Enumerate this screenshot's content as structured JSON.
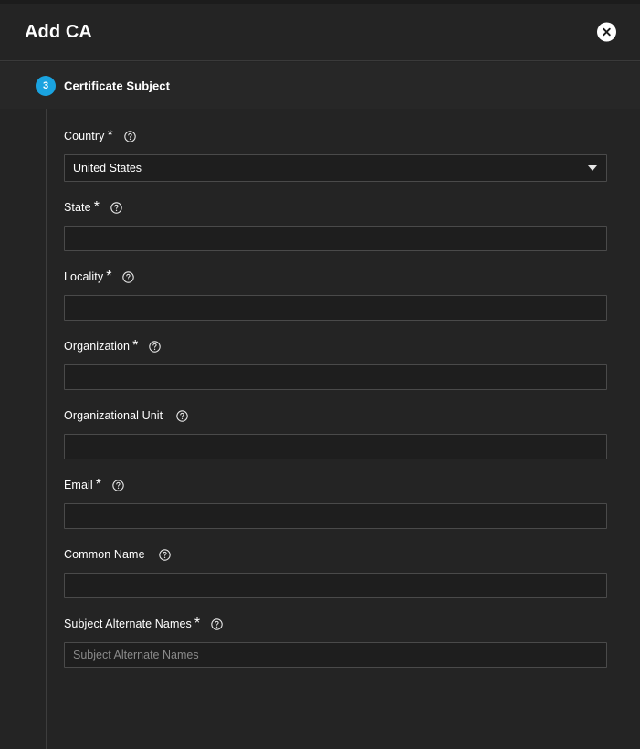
{
  "window": {
    "title": "Add CA",
    "close_icon": "close-circle-icon"
  },
  "step": {
    "number": "3",
    "label": "Certificate Subject"
  },
  "form": {
    "help_icon": "help-circle-icon",
    "dropdown_icon": "chevron-down-icon",
    "fields": [
      {
        "name": "country",
        "label": "Country",
        "required": true,
        "required_mark": "*",
        "type": "select",
        "value": "United States",
        "placeholder": ""
      },
      {
        "name": "state",
        "label": "State",
        "required": true,
        "required_mark": "*",
        "type": "text",
        "value": "",
        "placeholder": ""
      },
      {
        "name": "locality",
        "label": "Locality",
        "required": true,
        "required_mark": "*",
        "type": "text",
        "value": "",
        "placeholder": ""
      },
      {
        "name": "organization",
        "label": "Organization",
        "required": true,
        "required_mark": "*",
        "type": "text",
        "value": "",
        "placeholder": ""
      },
      {
        "name": "organizational-unit",
        "label": "Organizational Unit",
        "required": false,
        "required_mark": "",
        "type": "text",
        "value": "",
        "placeholder": ""
      },
      {
        "name": "email",
        "label": "Email",
        "required": true,
        "required_mark": "*",
        "type": "text",
        "value": "",
        "placeholder": ""
      },
      {
        "name": "common-name",
        "label": "Common Name",
        "required": false,
        "required_mark": "",
        "type": "text",
        "value": "",
        "placeholder": ""
      },
      {
        "name": "subject-alternate-names",
        "label": "Subject Alternate Names",
        "required": true,
        "required_mark": "*",
        "type": "text",
        "value": "",
        "placeholder": "Subject Alternate Names"
      }
    ]
  },
  "colors": {
    "background": "#242424",
    "panel": "#272727",
    "input_background": "#1e1e1e",
    "input_border": "#4a4a4a",
    "accent": "#1aa3e0",
    "divider": "#3a3a3a",
    "text": "#ffffff",
    "placeholder": "#8a8a8a"
  }
}
